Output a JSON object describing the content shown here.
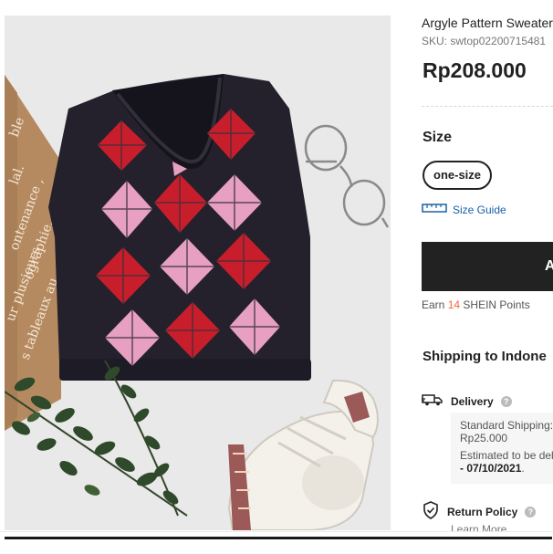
{
  "product": {
    "title": "Argyle Pattern Sweater",
    "sku": "SKU: swtop02200715481",
    "price": "Rp208.000"
  },
  "photo": {
    "card_text": [
      "ble",
      "lal.",
      "ontenance ,",
      "ographie.",
      "ur plusieurs",
      "s tableaux au"
    ],
    "colors": {
      "vest": "#24212d",
      "red": "#c81e2b",
      "pink": "#e79fc2",
      "background": "#e9e9e9"
    }
  },
  "size": {
    "heading": "Size",
    "options": [
      "one-size"
    ],
    "guide_label": "Size Guide"
  },
  "cart": {
    "button_label": "A"
  },
  "points": {
    "prefix": "Earn",
    "value": "14",
    "suffix": "SHEIN Points"
  },
  "shipping": {
    "heading": "Shipping to Indone",
    "delivery_label": "Delivery",
    "standard_label": "Standard Shipping:",
    "standard_price": "Rp25.000",
    "estimate_label": "Estimated to be del",
    "estimate_date": "- 07/10/2021",
    "estimate_tail": "."
  },
  "returns": {
    "label": "Return Policy",
    "link": "Learn More"
  },
  "icons": [
    "ruler-icon",
    "truck-icon",
    "shield-check-icon",
    "help-icon"
  ],
  "accent_colors": {
    "link": "#1860a7",
    "points": "#fa6338",
    "button": "#222222"
  }
}
